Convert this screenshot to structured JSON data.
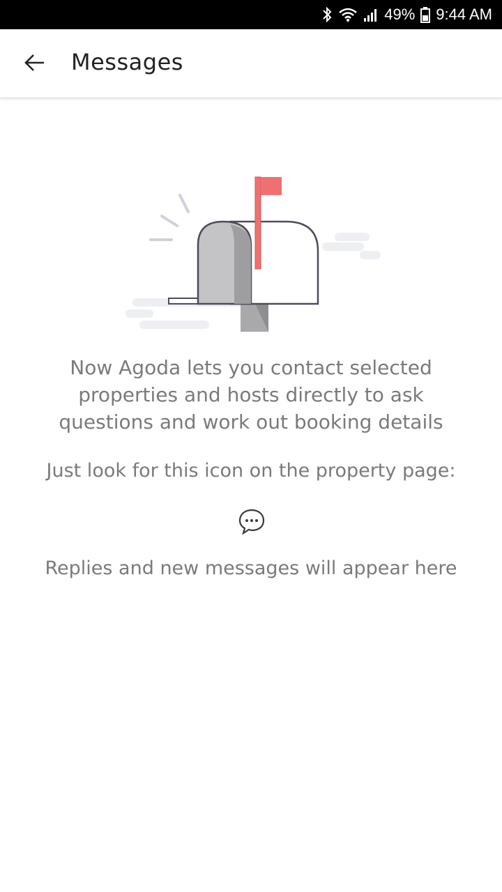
{
  "status_bar": {
    "battery_percent": "49%",
    "time": "9:44 AM",
    "icons": [
      "bluetooth-icon",
      "wifi-icon",
      "signal-icon",
      "battery-icon"
    ]
  },
  "header": {
    "back_icon": "arrow-left-icon",
    "title": "Messages"
  },
  "empty_state": {
    "illustration": "mailbox-illustration",
    "description": "Now Agoda lets you contact selected properties and hosts directly to ask questions and work out booking details",
    "hint": "Just look for this icon on the property page:",
    "hint_icon": "chat-bubble-icon",
    "replies_note": "Replies and new messages will appear here"
  },
  "colors": {
    "status_bar_bg": "#000000",
    "text_primary": "#222222",
    "text_secondary": "#7a7a7a",
    "flag": "#f07070"
  }
}
